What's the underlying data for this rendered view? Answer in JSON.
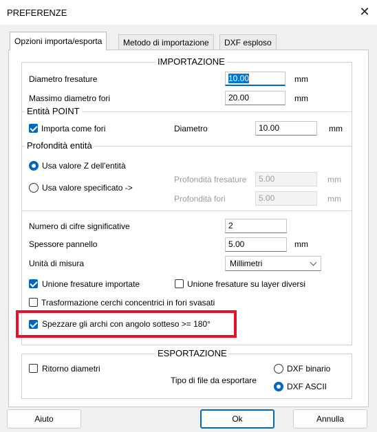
{
  "window": {
    "title": "PREFERENZE",
    "close_glyph": "✕"
  },
  "tabs": [
    {
      "label": "Opzioni importa/esporta",
      "active": true
    },
    {
      "label": "Metodo di importazione",
      "active": false
    },
    {
      "label": "DXF esploso",
      "active": false
    }
  ],
  "importazione": {
    "title": "IMPORTAZIONE",
    "diametro_fresature": {
      "label": "Diametro fresature",
      "value": "10.00",
      "unit": "mm"
    },
    "massimo_diametro_fori": {
      "label": "Massimo diametro fori",
      "value": "20.00",
      "unit": "mm"
    },
    "entita_point": {
      "title": "Entità POINT",
      "importa_come_fori": {
        "label": "Importa come fori",
        "checked": true
      },
      "diametro": {
        "label": "Diametro",
        "value": "10.00",
        "unit": "mm"
      }
    },
    "profondita": {
      "title": "Profondità entità",
      "radio_z": {
        "label": "Usa valore Z dell'entità",
        "selected": true
      },
      "radio_specificato": {
        "label": "Usa valore specificato ->",
        "selected": false
      },
      "prof_fresature": {
        "label": "Profondità fresature",
        "value": "5.00",
        "unit": "mm"
      },
      "prof_fori": {
        "label": "Profondità fori",
        "value": "5.00",
        "unit": "mm"
      }
    },
    "numero_cifre": {
      "label": "Numero di cifre significative",
      "value": "2"
    },
    "spessore_pannello": {
      "label": "Spessore pannello",
      "value": "5.00",
      "unit": "mm"
    },
    "unita_misura": {
      "label": "Unità di misura",
      "value": "Millimetri"
    },
    "unione_fresature": {
      "label": "Unione fresature importate",
      "checked": true
    },
    "unione_layer": {
      "label": "Unione fresature su layer diversi",
      "checked": false
    },
    "trasformazione_cerchi": {
      "label": "Trasformazione cerchi concentrici in fori svasati",
      "checked": false
    },
    "spezzare_archi": {
      "label": "Spezzare gli archi con angolo sotteso >= 180°",
      "checked": true
    }
  },
  "esportazione": {
    "title": "ESPORTAZIONE",
    "ritorno_diametri": {
      "label": "Ritorno diametri",
      "checked": false
    },
    "tipo_file_label": "Tipo di file da esportare",
    "dxf_binario": {
      "label": "DXF binario",
      "selected": false
    },
    "dxf_ascii": {
      "label": "DXF ASCII",
      "selected": true
    }
  },
  "buttons": {
    "aiuto": "Aiuto",
    "ok": "Ok",
    "annulla": "Annulla"
  },
  "colors": {
    "accent": "#0067c0",
    "highlight_box": "#e8102a"
  }
}
